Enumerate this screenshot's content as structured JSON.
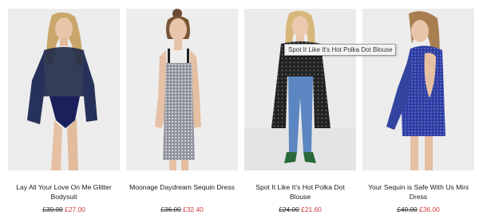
{
  "products": [
    {
      "name": "Lay All Your Love On Me Glitter Bodysuit",
      "was_price": "£30.00",
      "now_price": "£27.00",
      "image_alt": "Lay All Your Love On Me Glitter Bodysuit"
    },
    {
      "name": "Moonage Daydream Sequin Dress",
      "was_price": "£36.00",
      "now_price": "£32.40",
      "image_alt": "Moonage Daydream Sequin Dress"
    },
    {
      "name": "Spot It Like It's Hot Polka Dot Blouse",
      "was_price": "£24.00",
      "now_price": "£21.60",
      "image_alt": "Spot It Like It's Hot Polka Dot Blouse"
    },
    {
      "name": "Your Sequin is Safe With Us Mini Dress",
      "was_price": "£40.00",
      "now_price": "£36.00",
      "image_alt": "Your Sequin is Safe With Us Mini Dress"
    }
  ],
  "tooltip": "Spot It Like It's Hot Polka Dot Blouse",
  "colors": {
    "sale_price": "#d23a3a",
    "image_background": "#eeeeee"
  }
}
